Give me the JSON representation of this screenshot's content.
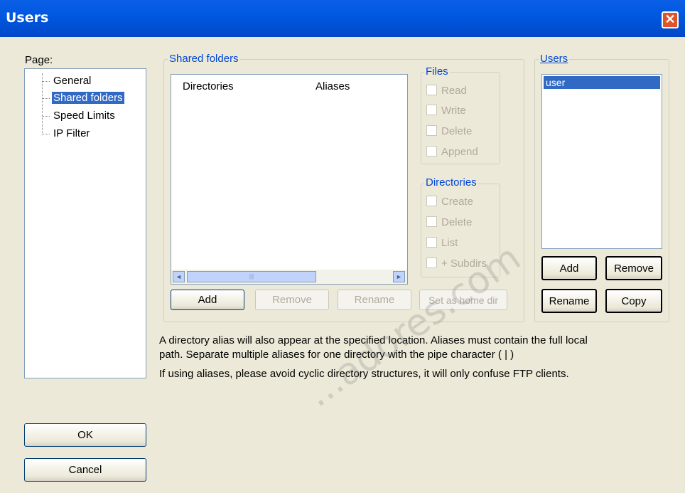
{
  "window": {
    "title": "Users",
    "close_label": "✕"
  },
  "page_label": "Page:",
  "tree": {
    "items": [
      "General",
      "Shared folders",
      "Speed Limits",
      "IP Filter"
    ],
    "selected_index": 1
  },
  "shared_folders": {
    "group_title": "Shared folders",
    "columns": [
      "Directories",
      "Aliases"
    ],
    "rows": [],
    "scroll_left": "◄",
    "scroll_right": "►",
    "scroll_grip": "|||"
  },
  "files": {
    "title": "Files",
    "options": [
      "Read",
      "Write",
      "Delete",
      "Append"
    ]
  },
  "directories": {
    "title": "Directories",
    "options": [
      "Create",
      "Delete",
      "List",
      "+ Subdirs"
    ]
  },
  "folder_buttons": {
    "add": "Add",
    "remove": "Remove",
    "rename": "Rename",
    "set_home": "Set as home dir"
  },
  "users": {
    "title": "Users",
    "list": [
      "user"
    ],
    "selected_index": 0,
    "add": "Add",
    "remove": "Remove",
    "rename": "Rename",
    "copy": "Copy"
  },
  "info": {
    "line1": "A directory alias will also appear at the specified location. Aliases must contain the full local",
    "line2": "path. Separate multiple aliases for one directory with the pipe character ( | )",
    "line3": "If using aliases, please avoid cyclic directory structures, it will only confuse FTP clients."
  },
  "dialog_buttons": {
    "ok": "OK",
    "cancel": "Cancel"
  },
  "watermark": "...adores.com"
}
